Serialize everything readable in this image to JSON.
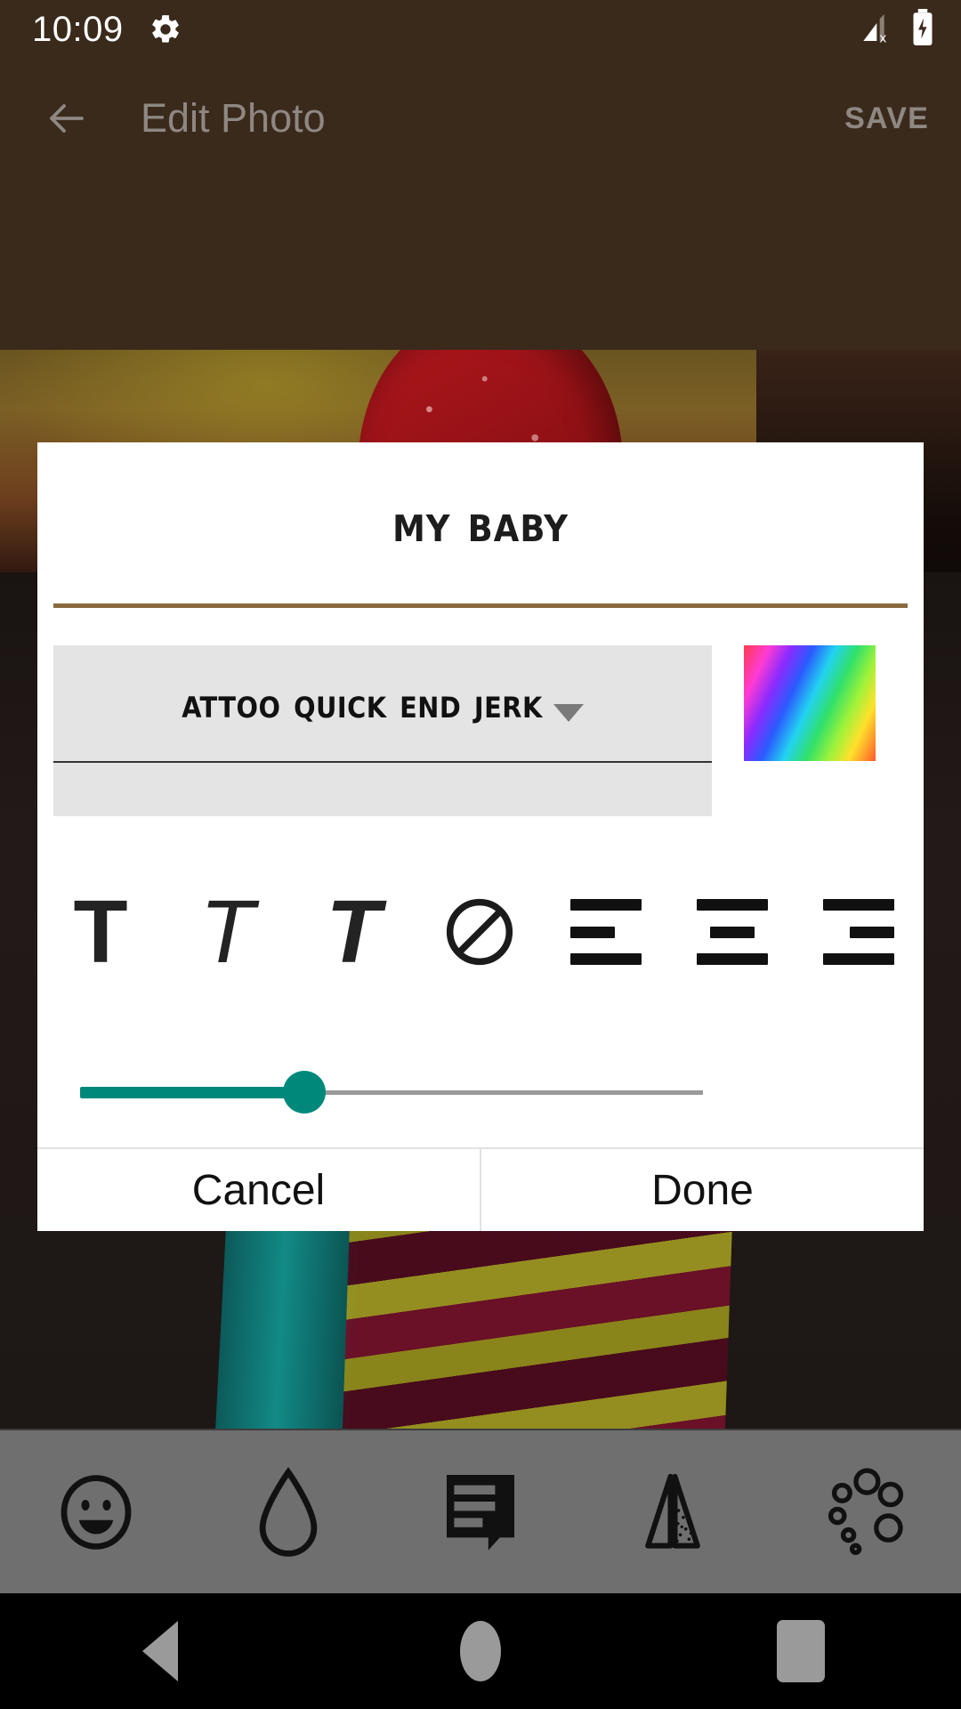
{
  "status_bar": {
    "time": "10:09",
    "gear_icon": "gear-icon",
    "signal_icon": "signal-no-service-icon",
    "battery_icon": "battery-charging-icon"
  },
  "app_bar": {
    "back_icon": "arrow-back-icon",
    "title": "Edit Photo",
    "save_label": "SAVE"
  },
  "dialog": {
    "title_text": "MY BABY",
    "accent_underline_color": "#8a6a3f",
    "font_picker": {
      "selected_font": "ATTOO QUICK END JERK",
      "caret_icon": "chevron-down-icon"
    },
    "color_swatch": {
      "name": "rainbow-gradient-swatch",
      "stops": [
        "#ff3b4e",
        "#ff3bd4",
        "#8b2bff",
        "#2b5bff",
        "#22d3f0",
        "#31e06a",
        "#9ef23a",
        "#ffe12b",
        "#ff5a2b"
      ]
    },
    "style_buttons": [
      {
        "name": "bold-text-icon",
        "glyph": "T"
      },
      {
        "name": "italic-text-icon",
        "glyph": "T"
      },
      {
        "name": "bold-italic-text-icon",
        "glyph": "T"
      },
      {
        "name": "no-style-icon",
        "glyph": ""
      },
      {
        "name": "align-left-icon",
        "glyph": ""
      },
      {
        "name": "align-center-icon",
        "glyph": ""
      },
      {
        "name": "align-right-icon",
        "glyph": ""
      }
    ],
    "opacity_slider": {
      "name": "text-size-slider",
      "value_percent": 36,
      "fill_color": "#00897b",
      "track_color": "#9a9a9a"
    },
    "cancel_label": "Cancel",
    "done_label": "Done"
  },
  "toolbar": {
    "items": [
      {
        "name": "sticker-smiley-icon"
      },
      {
        "name": "water-drop-icon"
      },
      {
        "name": "text-bubble-icon"
      },
      {
        "name": "mirror-flip-icon"
      },
      {
        "name": "bubbles-icon"
      }
    ]
  },
  "nav_bar": {
    "back_icon": "nav-back-icon",
    "home_icon": "nav-home-icon",
    "recents_icon": "nav-recents-icon"
  }
}
